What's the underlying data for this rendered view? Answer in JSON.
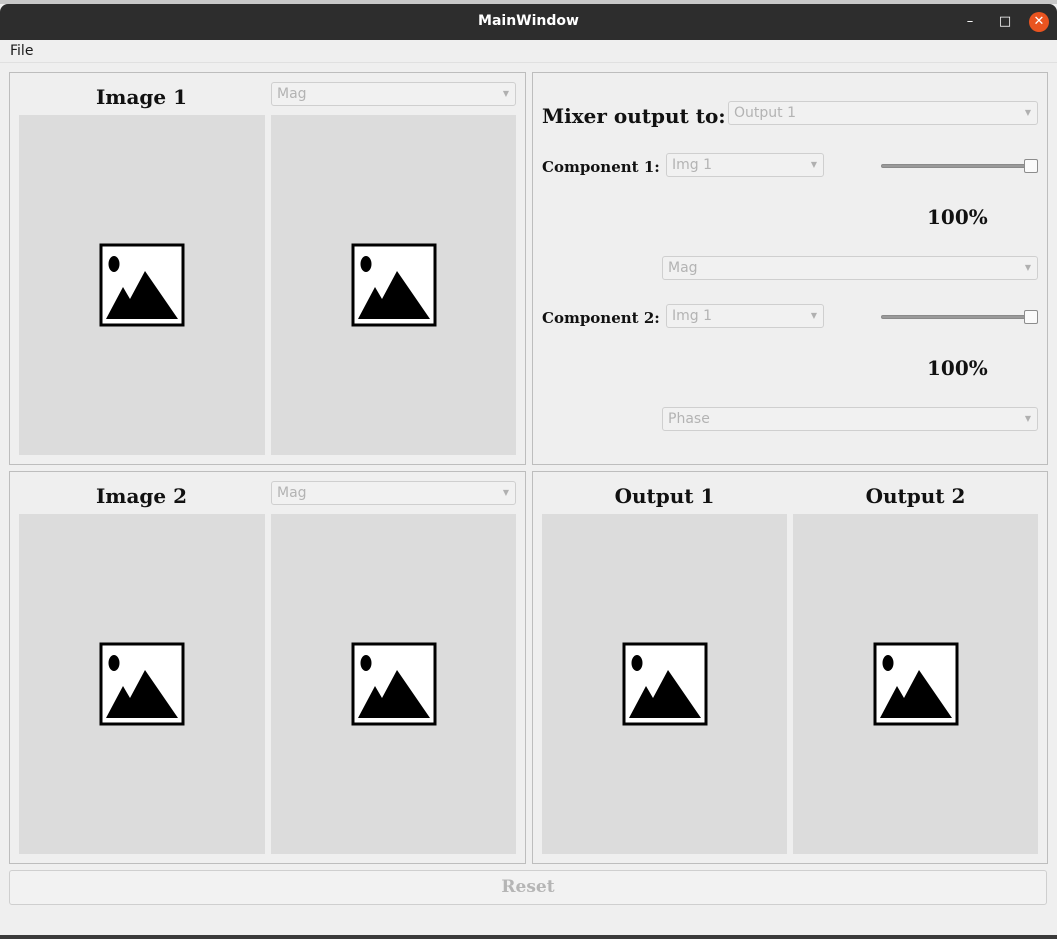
{
  "window": {
    "title": "MainWindow",
    "minimize_glyph": "–",
    "maximize_glyph": "□",
    "close_glyph": "✕"
  },
  "menu": {
    "file": "File"
  },
  "image1": {
    "title": "Image 1",
    "component_select": "Mag"
  },
  "image2": {
    "title": "Image 2",
    "component_select": "Mag"
  },
  "mixer": {
    "output_label": "Mixer output to:",
    "output_select": "Output 1",
    "component1": {
      "label": "Component 1:",
      "image_select": "Img 1",
      "percent": "100%",
      "slider_value": 100,
      "type_select": "Mag"
    },
    "component2": {
      "label": "Component 2:",
      "image_select": "Img 1",
      "percent": "100%",
      "slider_value": 100,
      "type_select": "Phase"
    }
  },
  "outputs": {
    "output1_title": "Output 1",
    "output2_title": "Output 2"
  },
  "reset_label": "Reset",
  "colors": {
    "titlebar": "#2d2d2d",
    "close_button": "#e95420",
    "viewer_bg": "#dcdcdc"
  },
  "icons": {
    "placeholder": "image-placeholder-icon",
    "dropdown": "chevron-down-icon"
  }
}
